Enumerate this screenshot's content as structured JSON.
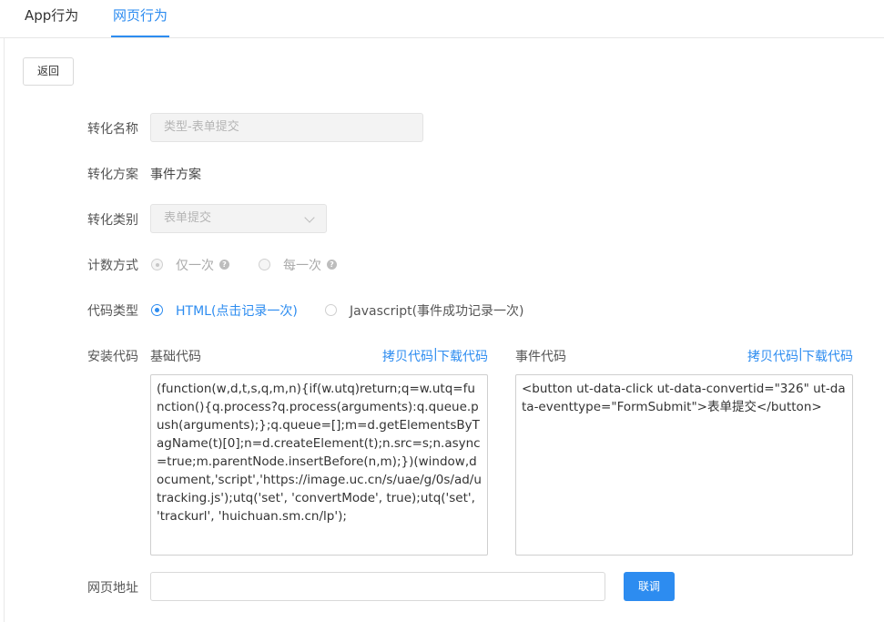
{
  "tabs": [
    {
      "label": "App行为",
      "active": false
    },
    {
      "label": "网页行为",
      "active": true
    }
  ],
  "back_label": "返回",
  "form": {
    "name_label": "转化名称",
    "name_placeholder": "类型-表单提交",
    "plan_label": "转化方案",
    "plan_value": "事件方案",
    "category_label": "转化类别",
    "category_value": "表单提交",
    "count_label": "计数方式",
    "count_options": [
      {
        "label": "仅一次",
        "checked": true,
        "disabled": true
      },
      {
        "label": "每一次",
        "checked": false,
        "disabled": true
      }
    ],
    "code_type_label": "代码类型",
    "code_type_options": [
      {
        "label": "HTML(点击记录一次)",
        "checked": true
      },
      {
        "label": "Javascript(事件成功记录一次)",
        "checked": false
      }
    ],
    "install_label": "安装代码",
    "base_code": {
      "title": "基础代码",
      "copy": "拷贝代码",
      "sep": "|",
      "download": "下载代码",
      "content": "(function(w,d,t,s,q,m,n){if(w.utq)return;q=w.utq=function(){q.process?q.process(arguments):q.queue.push(arguments);};q.queue=[];m=d.getElementsByTagName(t)[0];n=d.createElement(t);n.src=s;n.async=true;m.parentNode.insertBefore(n,m);})(window,document,'script','https://image.uc.cn/s/uae/g/0s/ad/utracking.js');utq('set', 'convertMode', true);utq('set', 'trackurl', 'huichuan.sm.cn/lp');"
    },
    "event_code": {
      "title": "事件代码",
      "copy": "拷贝代码",
      "sep": "|",
      "download": "下载代码",
      "content": "<button ut-data-click ut-data-convertid=\"326\" ut-data-eventtype=\"FormSubmit\">表单提交</button>"
    },
    "url_label": "网页地址",
    "url_value": "",
    "debug_label": "联调"
  },
  "colors": {
    "accent": "#2d8cf0",
    "help_icon": "#bdbdbd"
  }
}
